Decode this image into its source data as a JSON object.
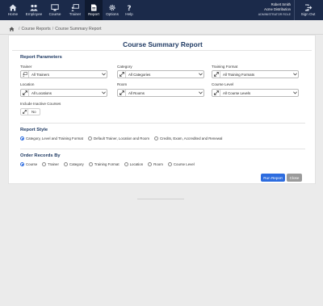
{
  "nav": {
    "items": [
      {
        "label": "Home",
        "icon": "home-icon"
      },
      {
        "label": "Employee",
        "icon": "people-icon"
      },
      {
        "label": "Course",
        "icon": "monitor-icon"
      },
      {
        "label": "Trainer",
        "icon": "presenter-icon"
      },
      {
        "label": "Report",
        "icon": "document-icon",
        "active": true
      },
      {
        "label": "Options",
        "icon": "gear-icon"
      },
      {
        "label": "Help",
        "icon": "question-icon"
      }
    ],
    "user_name": "Robert Smith",
    "company": "Acme Distribution",
    "role": "ADMINISTRATOR ROLE",
    "signout_label": "Sign Out"
  },
  "breadcrumb": {
    "items": [
      "Course Reports",
      "Course Summary Report"
    ],
    "separator": "/"
  },
  "page": {
    "title": "Course Summary Report"
  },
  "params": {
    "heading": "Report Parameters",
    "fields": [
      {
        "label": "Trainer",
        "value": "All Trainers",
        "icon": "presenter-icon"
      },
      {
        "label": "Category",
        "value": "All Categories",
        "icon": "expand-icon"
      },
      {
        "label": "Training Format",
        "value": "All Training Formats",
        "icon": "expand-icon"
      },
      {
        "label": "Location",
        "value": "All Locations",
        "icon": "expand-icon"
      },
      {
        "label": "Room",
        "value": "All Rooms",
        "icon": "expand-icon"
      },
      {
        "label": "Course Level",
        "value": "All Course Levels",
        "icon": "expand-icon"
      }
    ],
    "inactive_label": "Include Inactive Courses",
    "inactive_value": "No"
  },
  "style": {
    "heading": "Report Style",
    "options": [
      {
        "label": "Category, Level and Training Format",
        "checked": true
      },
      {
        "label": "Default Trainer, Location and Room",
        "checked": false
      },
      {
        "label": "Credits, Exam, Accredited and Renewal",
        "checked": false
      }
    ]
  },
  "order": {
    "heading": "Order Records By",
    "options": [
      {
        "label": "Course",
        "checked": true
      },
      {
        "label": "Trainer",
        "checked": false
      },
      {
        "label": "Category",
        "checked": false
      },
      {
        "label": "Training Format",
        "checked": false
      },
      {
        "label": "Location",
        "checked": false
      },
      {
        "label": "Room",
        "checked": false
      },
      {
        "label": "Course Level",
        "checked": false
      }
    ]
  },
  "actions": {
    "run_label": "Run Report",
    "close_label": "Close"
  },
  "colors": {
    "nav_bg": "#1b2a4a",
    "heading": "#1f3a63",
    "primary": "#2d6cdf",
    "secondary": "#9a9a9a"
  }
}
